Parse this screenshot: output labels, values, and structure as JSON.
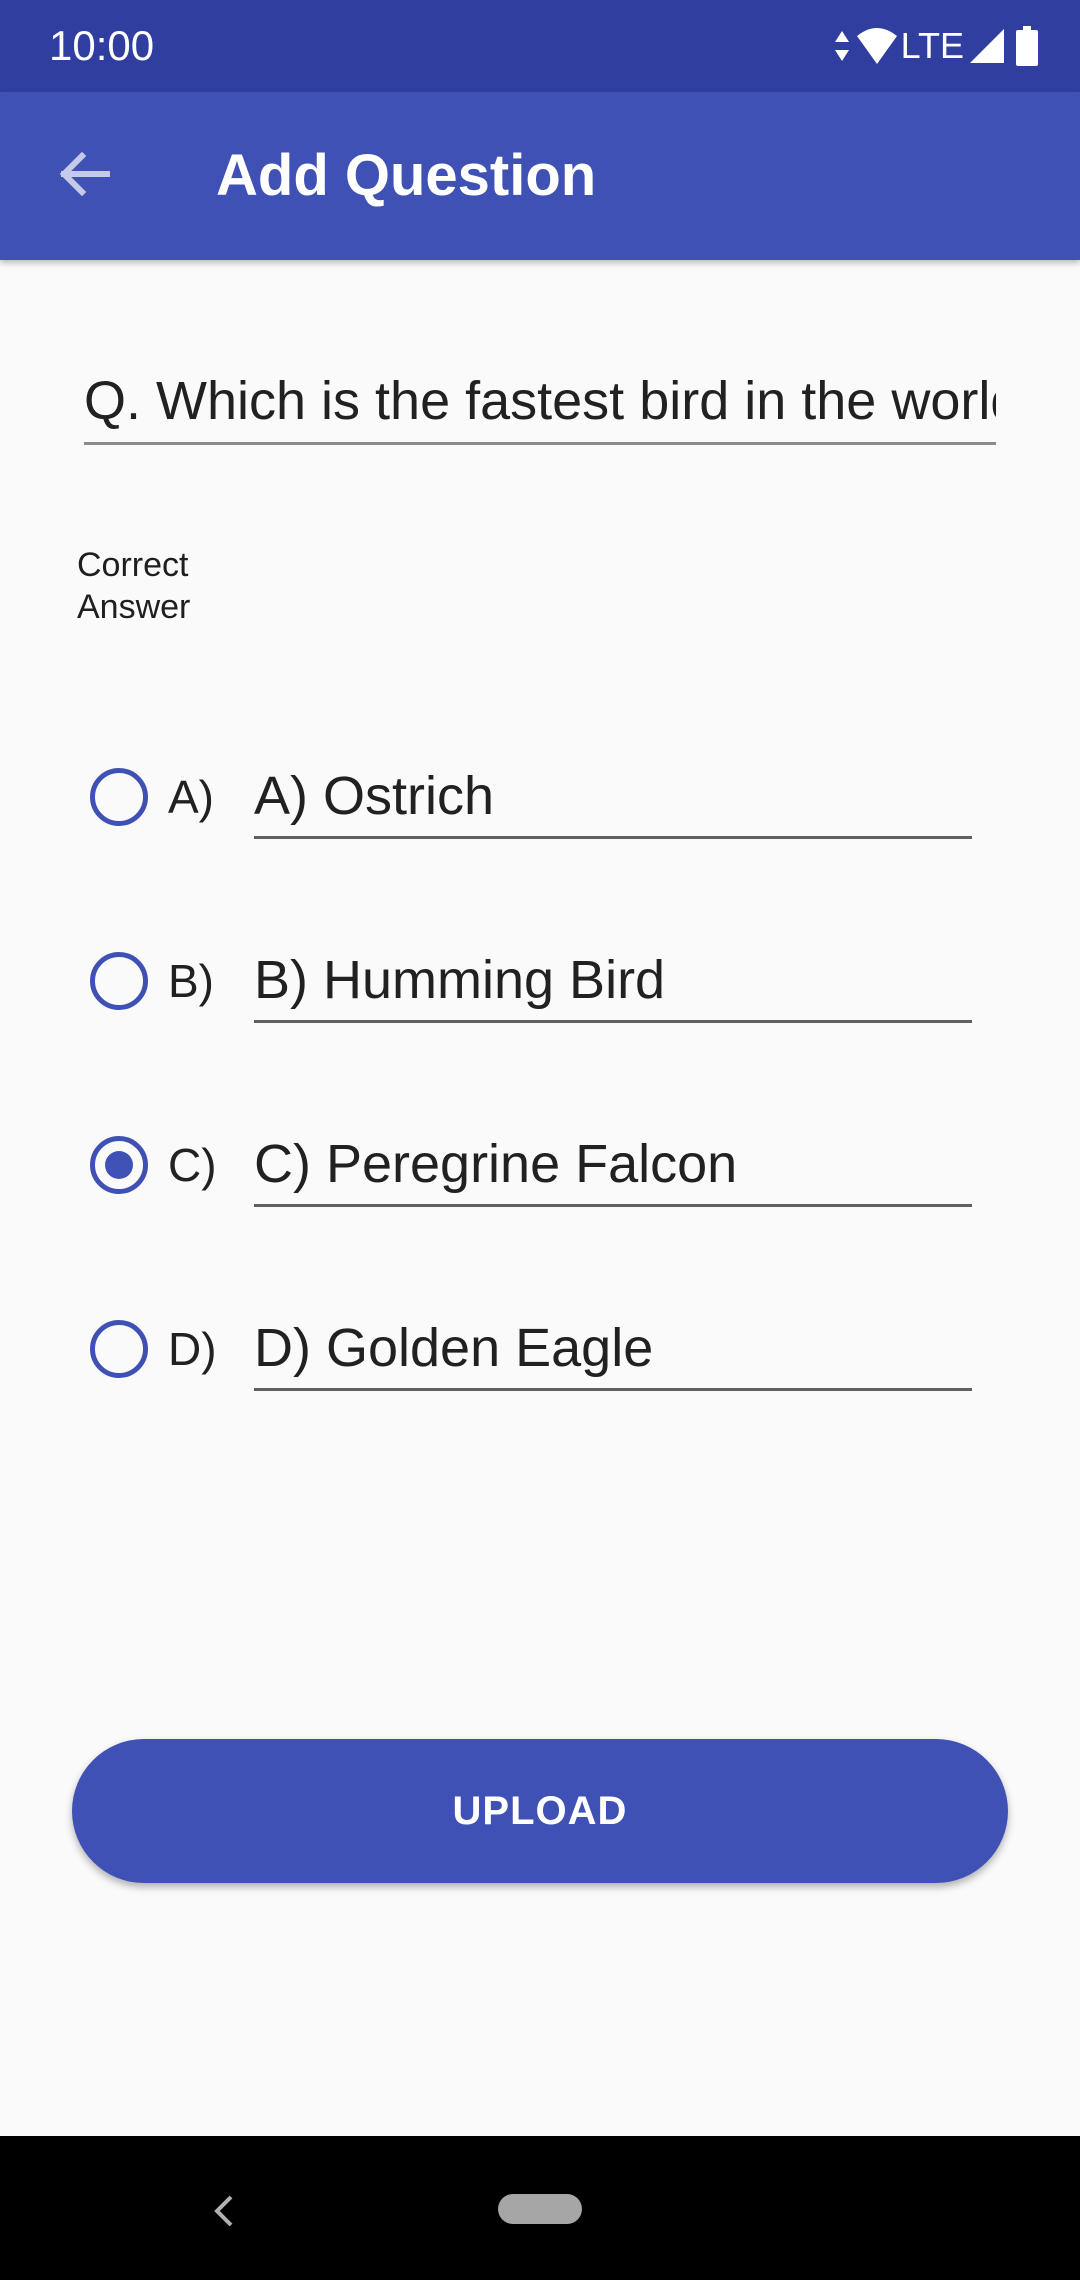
{
  "status_bar": {
    "time": "10:00",
    "network_label": "LTE",
    "icons": [
      "data-arrows-icon",
      "wifi-icon",
      "signal-icon",
      "battery-icon"
    ]
  },
  "app_bar": {
    "title": "Add Question",
    "back_icon": "arrow-back-icon"
  },
  "question": {
    "value": "Q. Which is the fastest bird in the world?"
  },
  "correct_answer_label": "Correct Answer",
  "options": [
    {
      "letter": "A)",
      "value": "A) Ostrich",
      "selected": false
    },
    {
      "letter": "B)",
      "value": "B) Humming Bird",
      "selected": false
    },
    {
      "letter": "C)",
      "value": "C) Peregrine Falcon",
      "selected": true
    },
    {
      "letter": "D)",
      "value": "D) Golden Eagle",
      "selected": false
    }
  ],
  "upload_button": {
    "label": "UPLOAD"
  },
  "nav_bar": {
    "icons": [
      "nav-back-icon",
      "nav-home-pill-icon"
    ]
  },
  "colors": {
    "status_bar": "#303f9f",
    "primary": "#3f51b5",
    "background": "#fafafa",
    "nav_bar": "#000000"
  }
}
